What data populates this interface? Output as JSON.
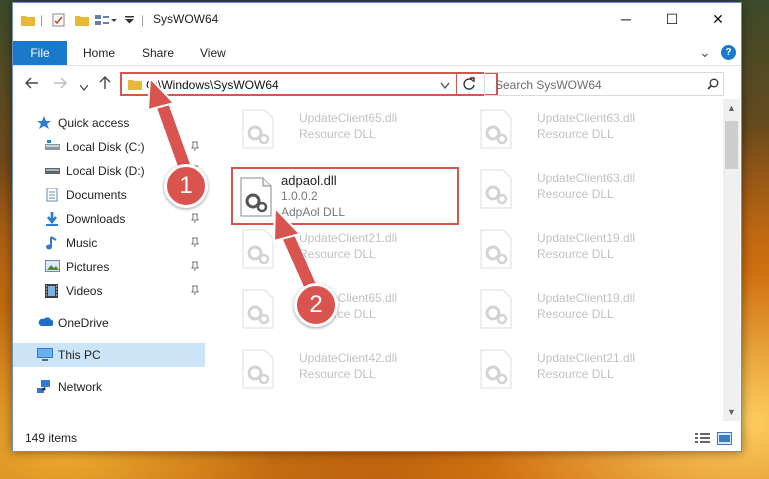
{
  "window": {
    "title": "SysWOW64",
    "controls": {
      "minimize": "─",
      "maximize": "☐",
      "close": "✕"
    }
  },
  "ribbon": {
    "tabs": [
      "File",
      "Home",
      "Share",
      "View"
    ],
    "expand_icon": "⌄",
    "help_icon": "?"
  },
  "address": {
    "path": "C:\\Windows\\SysWOW64",
    "search_placeholder": "Search SysWOW64"
  },
  "sidebar": {
    "items": [
      {
        "label": "Quick access",
        "icon": "star-icon"
      },
      {
        "label": "Local Disk (C:)",
        "icon": "drive-icon",
        "pinned": true
      },
      {
        "label": "Local Disk (D:)",
        "icon": "drive-icon",
        "pinned": true
      },
      {
        "label": "Documents",
        "icon": "documents-icon",
        "pinned": true
      },
      {
        "label": "Downloads",
        "icon": "download-icon",
        "pinned": true
      },
      {
        "label": "Music",
        "icon": "music-icon",
        "pinned": true
      },
      {
        "label": "Pictures",
        "icon": "pictures-icon",
        "pinned": true
      },
      {
        "label": "Videos",
        "icon": "video-icon",
        "pinned": true
      },
      {
        "label": "OneDrive",
        "icon": "cloud-icon"
      },
      {
        "label": "This PC",
        "icon": "computer-icon",
        "selected": true
      },
      {
        "label": "Network",
        "icon": "network-icon"
      }
    ]
  },
  "files": {
    "highlighted": {
      "name": "adpaol.dll",
      "version": "1.0.0.2",
      "description": "AdpAol DLL"
    },
    "tiles": [
      {
        "name": "UpdateClient65.dll",
        "type": "Resource DLL"
      },
      {
        "name": "UpdateClient63.dll",
        "type": "Resource DLL"
      },
      {
        "name": "UpdateClient63.dll",
        "type": "Resource DLL"
      },
      {
        "name": "UpdateClient21.dll",
        "type": "Resource DLL"
      },
      {
        "name": "UpdateClient19.dll",
        "type": "Resource DLL"
      },
      {
        "name": "UpdateClient65.dll",
        "type": "Resource DLL"
      },
      {
        "name": "UpdateClient19.dll",
        "type": "Resource DLL"
      },
      {
        "name": "UpdateClient42.dll",
        "type": "Resource DLL"
      },
      {
        "name": "UpdateClient21.dll",
        "type": "Resource DLL"
      }
    ]
  },
  "status": {
    "item_count": "149 items"
  },
  "callouts": {
    "one": "1",
    "two": "2",
    "color": "#d9534f"
  }
}
